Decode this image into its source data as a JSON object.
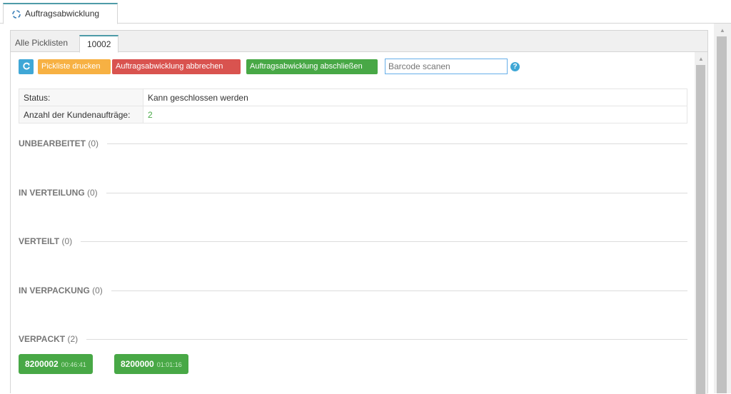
{
  "window": {
    "tab_title": "Auftragsabwicklung",
    "tab_icon": "process-cycle-icon"
  },
  "subtabs": [
    {
      "label": "Alle Picklisten",
      "active": false
    },
    {
      "label": "10002",
      "active": true
    }
  ],
  "toolbar": {
    "refresh_icon": "refresh-icon",
    "print_label": "Pickliste drucken",
    "cancel_label": "Auftragsabwicklung abbrechen",
    "finish_label": "Auftragsabwicklung abschließen",
    "barcode_placeholder": "Barcode scanen",
    "help_glyph": "?"
  },
  "info": {
    "status_label": "Status:",
    "status_value": "Kann geschlossen werden",
    "count_label": "Anzahl der Kundenaufträge:",
    "count_value": "2"
  },
  "sections": [
    {
      "title": "UNBEARBEITET",
      "count": "(0)"
    },
    {
      "title": "IN VERTEILUNG",
      "count": "(0)"
    },
    {
      "title": "VERTEILT",
      "count": "(0)"
    },
    {
      "title": "IN VERPACKUNG",
      "count": "(0)"
    },
    {
      "title": "VERPACKT",
      "count": "(2)"
    }
  ],
  "orders": [
    {
      "number": "8200002",
      "time": "00:46:41"
    },
    {
      "number": "8200000",
      "time": "01:01:16"
    }
  ],
  "colors": {
    "primary": "#3fa7d6",
    "warning": "#f7b143",
    "danger": "#d9534f",
    "success": "#48a846",
    "tab_accent": "#4e9ba8"
  }
}
